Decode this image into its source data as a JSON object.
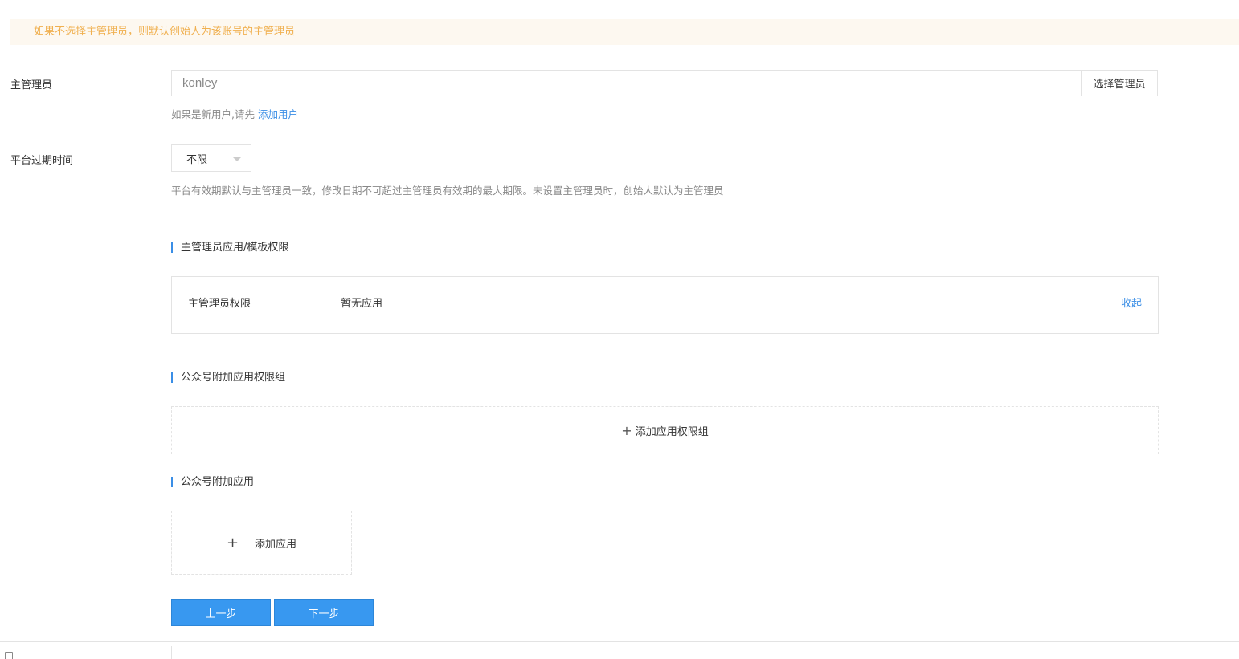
{
  "notice": "如果不选择主管理员，则默认创始人为该账号的主管理员",
  "admin": {
    "label": "主管理员",
    "value": "konley",
    "select_button": "选择管理员",
    "hint_prefix": "如果是新用户,请先 ",
    "hint_link": "添加用户"
  },
  "expire": {
    "label": "平台过期时间",
    "selected": "不限",
    "hint": "平台有效期默认与主管理员一致，修改日期不可超过主管理员有效期的最大期限。未设置主管理员时，创始人默认为主管理员"
  },
  "admin_perm": {
    "title": "主管理员应用/模板权限",
    "row_label": "主管理员权限",
    "row_value": "暂无应用",
    "collapse": "收起"
  },
  "perm_group": {
    "title": "公众号附加应用权限组",
    "add_label": "添加应用权限组"
  },
  "extra_app": {
    "title": "公众号附加应用",
    "add_label": "添加应用"
  },
  "buttons": {
    "prev": "上一步",
    "next": "下一步"
  },
  "icons": {
    "plus": "plus-icon",
    "caret": "chevron-down-icon",
    "document": "document-icon"
  }
}
